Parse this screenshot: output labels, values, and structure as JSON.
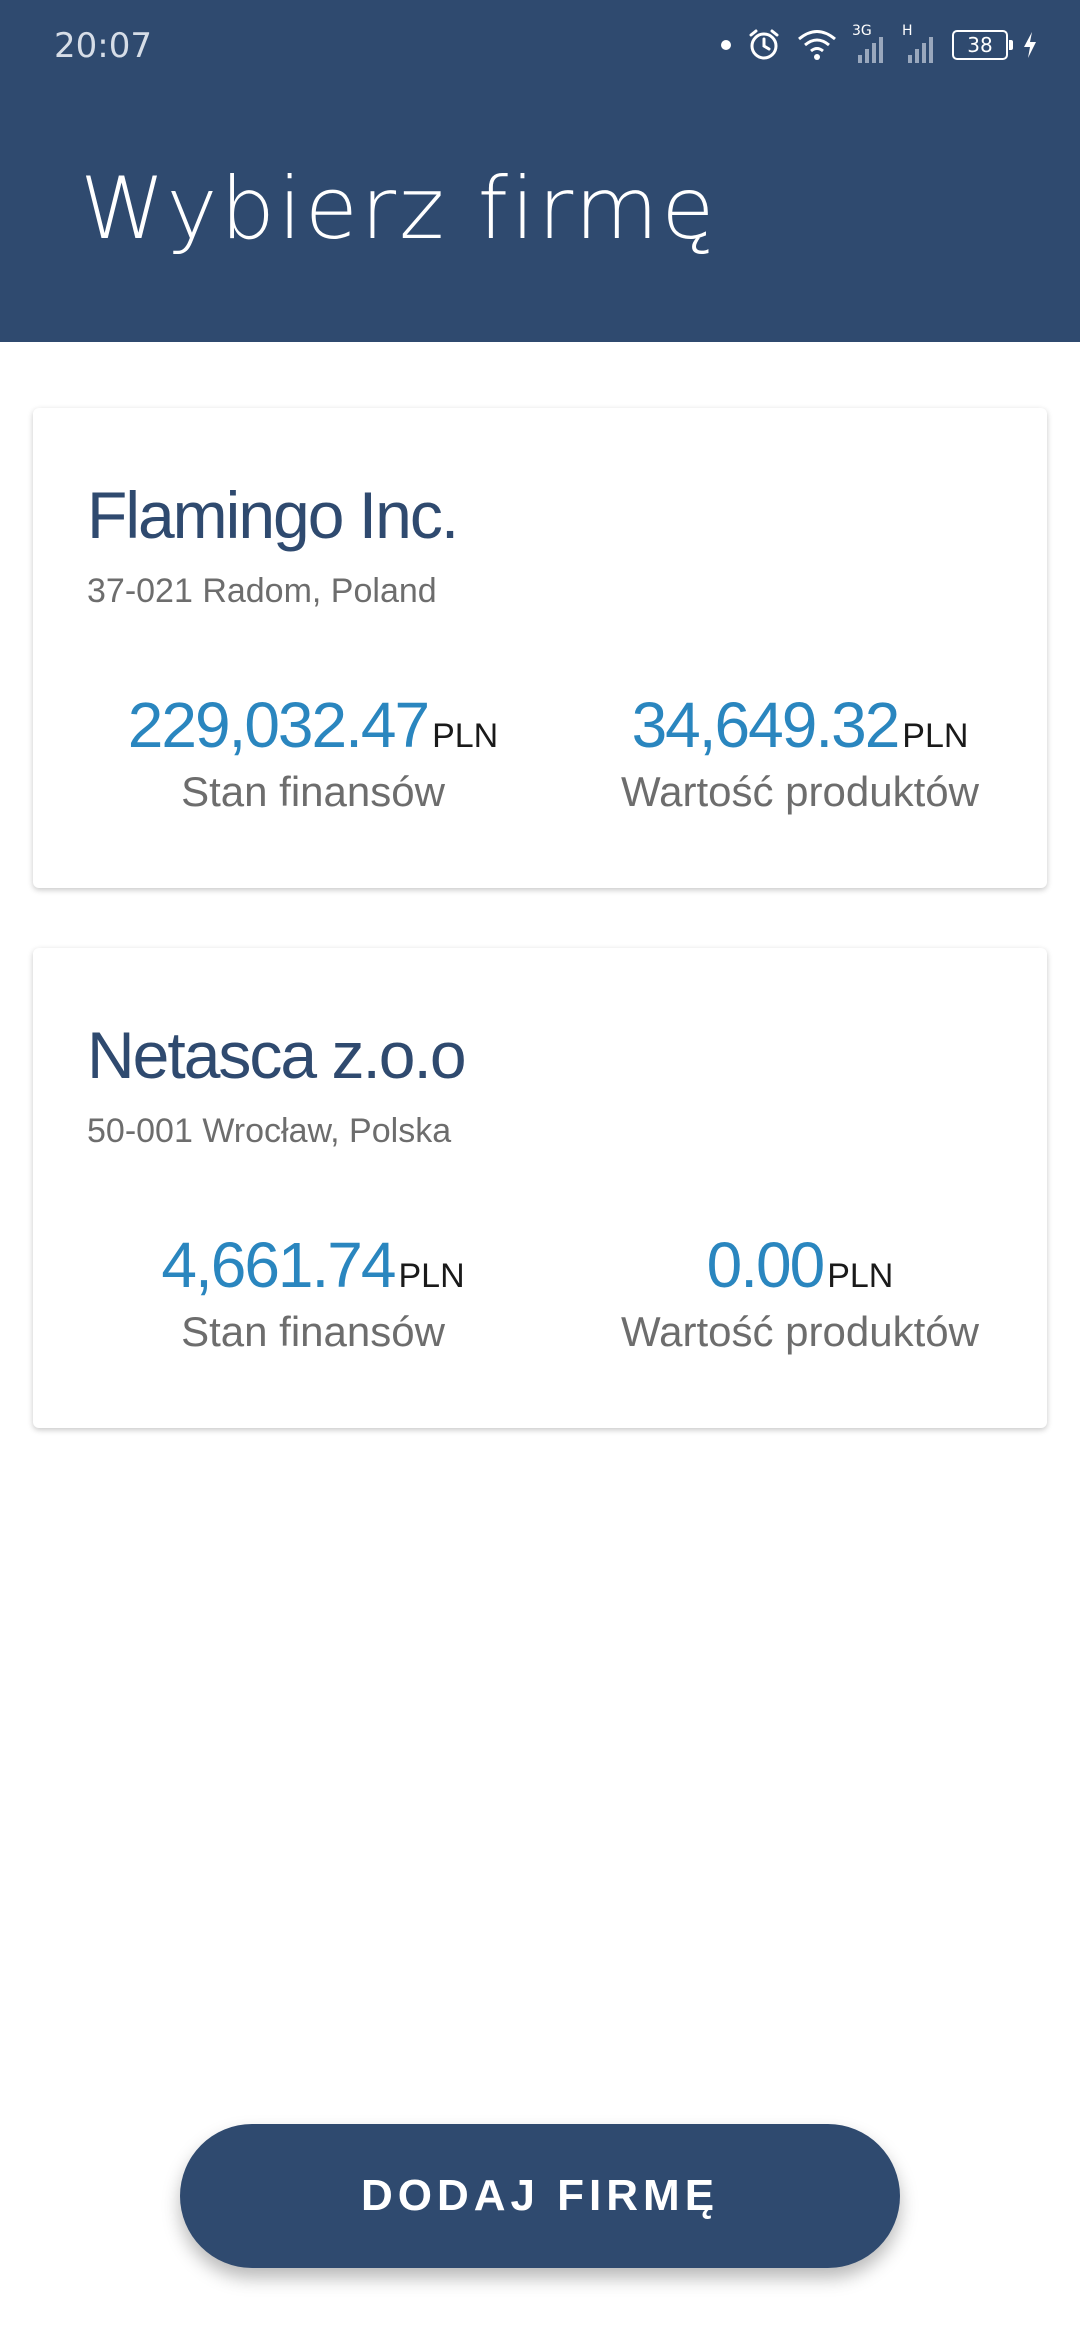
{
  "status_bar": {
    "time": "20:07",
    "network_1": "3G",
    "network_2": "H",
    "battery": "38"
  },
  "header": {
    "title": "Wybierz firmę",
    "background_color": "#2f4a6f"
  },
  "companies": [
    {
      "name": "Flamingo Inc.",
      "address": "37-021 Radom, Poland",
      "finance_amount": "229,032.47",
      "finance_currency": "PLN",
      "finance_label": "Stan finansów",
      "products_amount": "34,649.32",
      "products_currency": "PLN",
      "products_label": "Wartość produktów"
    },
    {
      "name": "Netasca z.o.o",
      "address": "50-001 Wrocław, Polska",
      "finance_amount": "4,661.74",
      "finance_currency": "PLN",
      "finance_label": "Stan finansów",
      "products_amount": "0.00",
      "products_currency": "PLN",
      "products_label": "Wartość produktów"
    }
  ],
  "actions": {
    "add_company_label": "DODAJ FIRMĘ"
  },
  "colors": {
    "amount": "#2a86bf",
    "company_name": "#2f4a6f"
  },
  "icons": [
    "dot-icon",
    "alarm-icon",
    "wifi-icon",
    "signal-icon",
    "battery-icon",
    "charging-icon"
  ]
}
